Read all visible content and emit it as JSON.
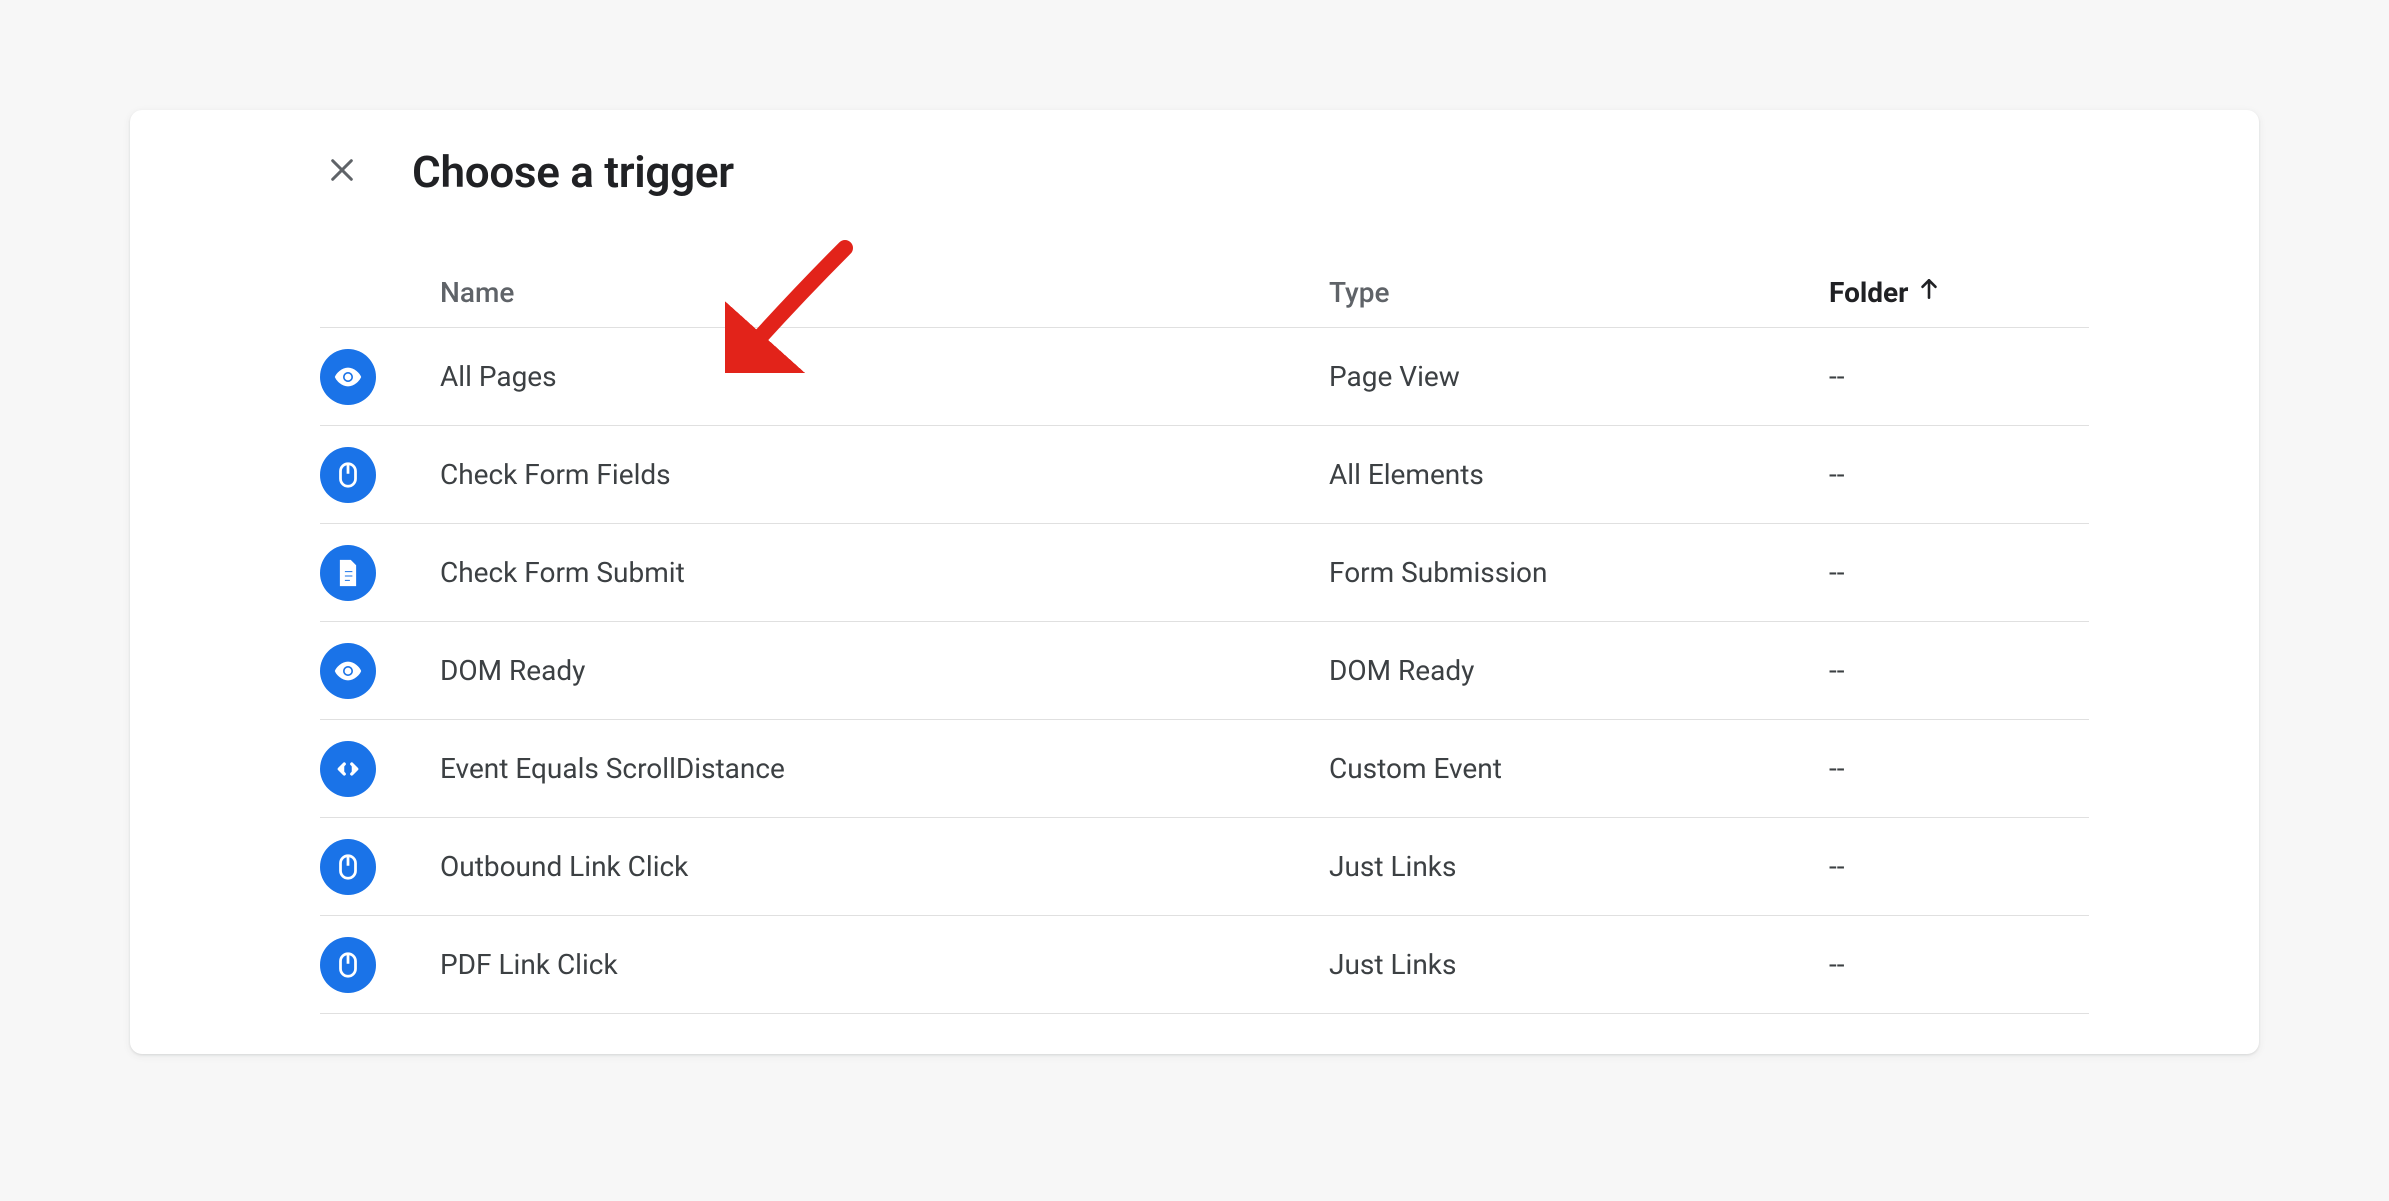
{
  "header": {
    "title": "Choose a trigger"
  },
  "columns": {
    "name": "Name",
    "type": "Type",
    "folder": "Folder"
  },
  "rows": [
    {
      "icon": "eye",
      "name": "All Pages",
      "type": "Page View",
      "folder": "--"
    },
    {
      "icon": "mouse",
      "name": "Check Form Fields",
      "type": "All Elements",
      "folder": "--"
    },
    {
      "icon": "doc",
      "name": "Check Form Submit",
      "type": "Form Submission",
      "folder": "--"
    },
    {
      "icon": "eye",
      "name": "DOM Ready",
      "type": "DOM Ready",
      "folder": "--"
    },
    {
      "icon": "code",
      "name": "Event Equals ScrollDistance",
      "type": "Custom Event",
      "folder": "--"
    },
    {
      "icon": "mouse",
      "name": "Outbound Link Click",
      "type": "Just Links",
      "folder": "--"
    },
    {
      "icon": "mouse",
      "name": "PDF Link Click",
      "type": "Just Links",
      "folder": "--"
    }
  ]
}
